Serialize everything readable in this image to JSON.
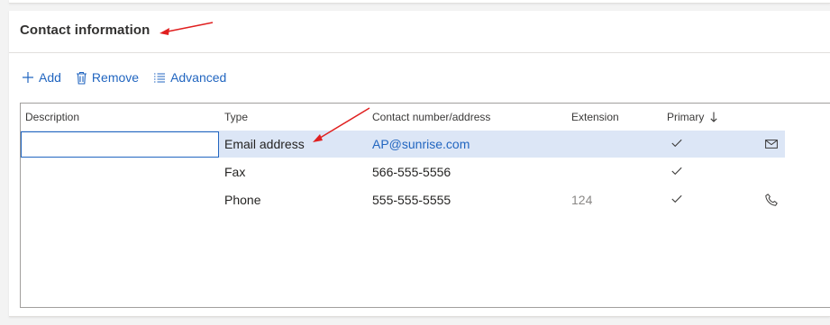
{
  "section": {
    "title": "Contact information"
  },
  "toolbar": {
    "add_label": "Add",
    "remove_label": "Remove",
    "advanced_label": "Advanced"
  },
  "grid": {
    "columns": [
      "Description",
      "Type",
      "Contact number/address",
      "Extension",
      "Primary"
    ],
    "sort": {
      "column": "Primary",
      "direction": "descending"
    },
    "rows": [
      {
        "description": "",
        "type": "Email address",
        "contact": "AP@sunrise.com",
        "extension": "",
        "primary": true,
        "action_icon": "mail-icon",
        "selected": true
      },
      {
        "description": "",
        "type": "Fax",
        "contact": "566-555-5556",
        "extension": "",
        "primary": true,
        "action_icon": "",
        "selected": false
      },
      {
        "description": "",
        "type": "Phone",
        "contact": "555-555-5555",
        "extension": "124",
        "primary": true,
        "action_icon": "phone-icon",
        "selected": false
      }
    ]
  },
  "colors": {
    "accent": "#2266c0",
    "selected_row": "#dce6f6",
    "annotation_arrow": "#e02020"
  }
}
